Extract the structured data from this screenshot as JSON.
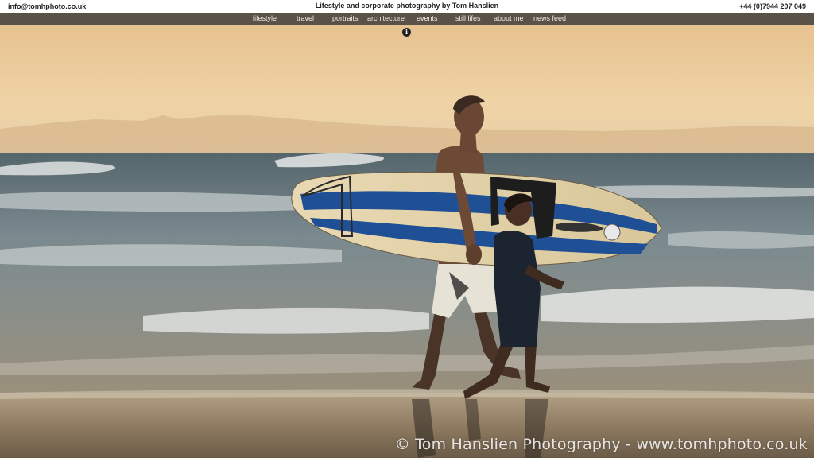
{
  "header": {
    "email": "info@tomhphoto.co.uk",
    "title": "Lifestyle and corporate photography by Tom Hanslien",
    "phone": "+44 (0)7944 207 049"
  },
  "nav": {
    "items": [
      {
        "label": "lifestyle"
      },
      {
        "label": "travel"
      },
      {
        "label": "portraits"
      },
      {
        "label": "architecture"
      },
      {
        "label": "events"
      },
      {
        "label": "still lifes"
      },
      {
        "label": "about me"
      },
      {
        "label": "news feed"
      }
    ]
  },
  "info": {
    "icon": "info-icon",
    "glyph": "i"
  },
  "photo": {
    "watermark": "© Tom Hanslien Photography  -  www.tomhphoto.co.uk"
  },
  "colors": {
    "navbar": "#5a5248",
    "sky": "#e9c99a",
    "sea": "#6f7f86",
    "sand": "#a08a6e"
  }
}
